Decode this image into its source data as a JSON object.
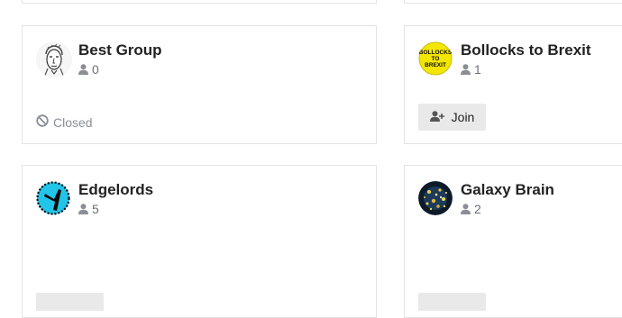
{
  "groups": [
    {
      "name": "Best Group",
      "member_count": "0",
      "status_label": "Closed",
      "avatar": "face-sketch-avatar"
    },
    {
      "name": "Bollocks to Brexit",
      "member_count": "1",
      "join_label": "Join",
      "avatar": "badge-avatar",
      "avatar_text": "BOLLOCKS TO BREXIT"
    },
    {
      "name": "Edgelords",
      "member_count": "5",
      "avatar": "edge-avatar"
    },
    {
      "name": "Galaxy Brain",
      "member_count": "2",
      "avatar": "galaxy-avatar"
    }
  ],
  "colors": {
    "title": "#222222",
    "meta": "#6b6f78",
    "border": "#e3e3e3",
    "button_bg": "#e9e9e9",
    "badge_yellow": "#f3e600",
    "edge_blue": "#22c5e8"
  }
}
